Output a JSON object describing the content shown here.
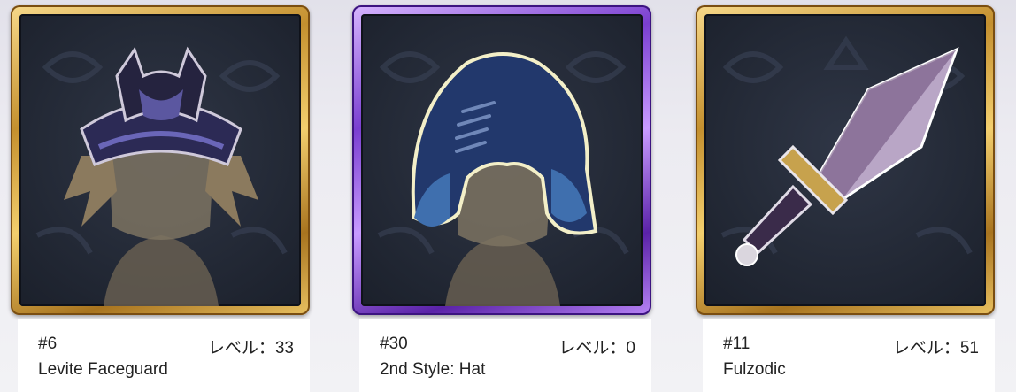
{
  "cards": [
    {
      "number": "#6",
      "level_text": "レベル：33",
      "name": "Levite Faceguard",
      "frame": "gold",
      "icon": "faceguard-icon",
      "colors": {
        "frame": "#c4902f",
        "item": "#2c2a55"
      }
    },
    {
      "number": "#30",
      "level_text": "レベル：0",
      "name": "2nd Style: Hat",
      "frame": "purple",
      "icon": "hood-hat-icon",
      "colors": {
        "frame": "#7a3fd0",
        "item": "#22386c"
      }
    },
    {
      "number": "#11",
      "level_text": "レベル：51",
      "name": "Fulzodic",
      "frame": "gold",
      "icon": "dagger-icon",
      "colors": {
        "frame": "#c4902f",
        "item": "#b9a6c6"
      }
    }
  ]
}
